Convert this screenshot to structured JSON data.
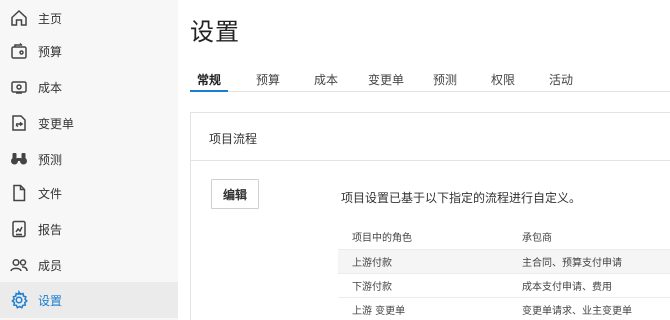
{
  "sidebar": {
    "items": [
      {
        "label": "主页",
        "icon": "home-icon"
      },
      {
        "label": "预算",
        "icon": "budget-icon"
      },
      {
        "label": "成本",
        "icon": "cost-icon"
      },
      {
        "label": "变更单",
        "icon": "change-order-icon"
      },
      {
        "label": "预测",
        "icon": "binoculars-icon"
      },
      {
        "label": "文件",
        "icon": "file-icon"
      },
      {
        "label": "报告",
        "icon": "report-icon"
      },
      {
        "label": "成员",
        "icon": "members-icon"
      },
      {
        "label": "设置",
        "icon": "gear-icon",
        "active": true
      }
    ]
  },
  "page": {
    "title": "设置"
  },
  "tabs": [
    {
      "label": "常规",
      "active": true
    },
    {
      "label": "预算"
    },
    {
      "label": "成本"
    },
    {
      "label": "变更单"
    },
    {
      "label": "预测"
    },
    {
      "label": "权限"
    },
    {
      "label": "活动"
    }
  ],
  "panel": {
    "title": "项目流程",
    "edit_label": "编辑",
    "description": "项目设置已基于以下指定的流程进行自定义。",
    "table": {
      "headers": [
        "项目中的角色",
        "承包商"
      ],
      "rows": [
        [
          "上游付款",
          "主合同、预算支付申请"
        ],
        [
          "下游付款",
          "成本支付申请、费用"
        ],
        [
          "上游 变更单",
          "变更单请求、业主变更单"
        ]
      ]
    }
  },
  "colors": {
    "accent": "#1a7dd0",
    "sidebar_bg": "#f7f7f7",
    "active_bg": "#ebebeb"
  }
}
